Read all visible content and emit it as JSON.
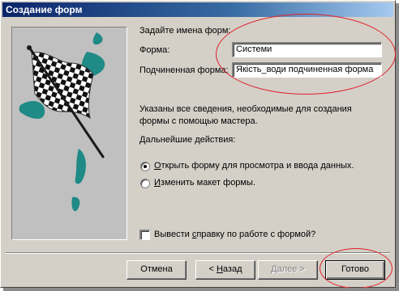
{
  "window": {
    "title": "Создание форм"
  },
  "form_names": {
    "heading": "Задайте имена форм:",
    "form_label": "Форма:",
    "form_value": "Системи",
    "subform_label": "Подчиненная форма:",
    "subform_value": "Якість_води подчиненная форма"
  },
  "info": {
    "line1": "Указаны все сведения, необходимые для создания",
    "line2": "формы с помощью мастера.",
    "next_actions_label": "Дальнейшие действия:"
  },
  "options": {
    "open_form": {
      "mnemonic": "О",
      "rest": "ткрыть форму для просмотра и ввода данных.",
      "selected": true
    },
    "modify_layout": {
      "mnemonic": "И",
      "rest": "зменить макет формы.",
      "selected": false
    }
  },
  "help_checkbox": {
    "before": "Вывести ",
    "mnemonic": "с",
    "after": "правку по работе с формой?",
    "checked": false
  },
  "buttons": {
    "cancel": "Отмена",
    "back_prefix": "< ",
    "back_mnemonic": "Н",
    "back_rest": "азад",
    "next_mnemonic": "Д",
    "next_rest": "алее >",
    "finish": "Готово"
  },
  "colors": {
    "dialog_face": "#d4d0c8",
    "title_bar": "#0a246a",
    "highlight_ellipse": "#e0202a",
    "flag_teal": "#1f8a86"
  },
  "icons": {
    "wizard_picture": "checkered-flag"
  }
}
